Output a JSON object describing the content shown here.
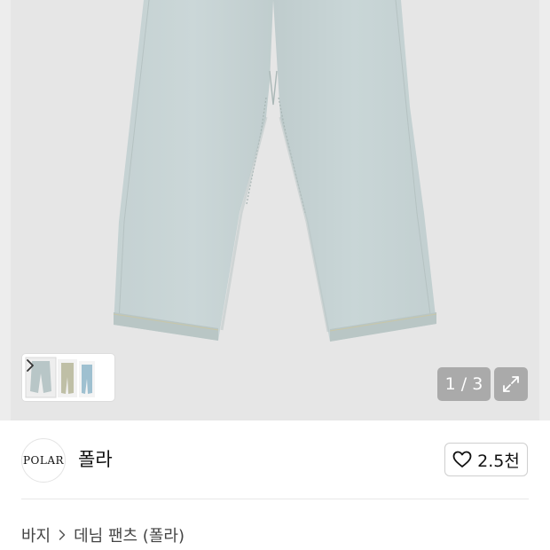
{
  "gallery": {
    "counter": "1 / 3",
    "current_page": 1,
    "total_pages": 3,
    "thumbnails_count": 3,
    "image_subject": "light blue wide denim jeans"
  },
  "brand": {
    "logo_text": "POLAR",
    "name": "폴라",
    "likes": "2.5천"
  },
  "breadcrumb": {
    "category": "바지",
    "product": "데님 팬츠 (폴라)"
  },
  "colors": {
    "hero_bg": "#e6e6e6",
    "denim": "#c5d2d3",
    "overlay": "#8a8a8a"
  },
  "icons": {
    "thumb_next": "chevron-right-icon",
    "expand": "expand-icon",
    "like": "heart-outline-icon",
    "breadcrumb_sep": "chevron-right-icon"
  }
}
